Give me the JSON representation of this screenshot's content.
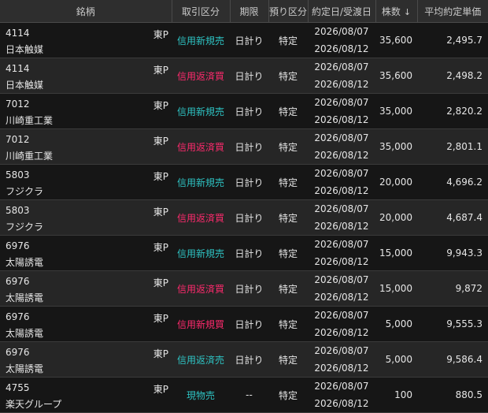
{
  "colors": {
    "buy": "#2ec4c4",
    "sell": "#ff2a6d",
    "text": "#e6e6e6",
    "header_bg": "#2e2e2e"
  },
  "headers": {
    "stock": "銘柄",
    "trade_type": "取引区分",
    "term": "期限",
    "custody": "預り区分",
    "dates": "約定日/受渡日",
    "qty": "株数",
    "sort_icon": "↓",
    "avg_price": "平均約定単価"
  },
  "rows": [
    {
      "code": "4114",
      "name": "日本触媒",
      "market": "東P",
      "trade_type": "信用新規売",
      "trade_kind": "buy",
      "term": "日計り",
      "custody": "特定",
      "trade_date": "2026/08/07",
      "settle_date": "2026/08/12",
      "qty": "35,600",
      "price": "2,495.7"
    },
    {
      "code": "4114",
      "name": "日本触媒",
      "market": "東P",
      "trade_type": "信用返済買",
      "trade_kind": "sell",
      "term": "日計り",
      "custody": "特定",
      "trade_date": "2026/08/07",
      "settle_date": "2026/08/12",
      "qty": "35,600",
      "price": "2,498.2"
    },
    {
      "code": "7012",
      "name": "川崎重工業",
      "market": "東P",
      "trade_type": "信用新規売",
      "trade_kind": "buy",
      "term": "日計り",
      "custody": "特定",
      "trade_date": "2026/08/07",
      "settle_date": "2026/08/12",
      "qty": "35,000",
      "price": "2,820.2"
    },
    {
      "code": "7012",
      "name": "川崎重工業",
      "market": "東P",
      "trade_type": "信用返済買",
      "trade_kind": "sell",
      "term": "日計り",
      "custody": "特定",
      "trade_date": "2026/08/07",
      "settle_date": "2026/08/12",
      "qty": "35,000",
      "price": "2,801.1"
    },
    {
      "code": "5803",
      "name": "フジクラ",
      "market": "東P",
      "trade_type": "信用新規売",
      "trade_kind": "buy",
      "term": "日計り",
      "custody": "特定",
      "trade_date": "2026/08/07",
      "settle_date": "2026/08/12",
      "qty": "20,000",
      "price": "4,696.2"
    },
    {
      "code": "5803",
      "name": "フジクラ",
      "market": "東P",
      "trade_type": "信用返済買",
      "trade_kind": "sell",
      "term": "日計り",
      "custody": "特定",
      "trade_date": "2026/08/07",
      "settle_date": "2026/08/12",
      "qty": "20,000",
      "price": "4,687.4"
    },
    {
      "code": "6976",
      "name": "太陽誘電",
      "market": "東P",
      "trade_type": "信用新規売",
      "trade_kind": "buy",
      "term": "日計り",
      "custody": "特定",
      "trade_date": "2026/08/07",
      "settle_date": "2026/08/12",
      "qty": "15,000",
      "price": "9,943.3"
    },
    {
      "code": "6976",
      "name": "太陽誘電",
      "market": "東P",
      "trade_type": "信用返済買",
      "trade_kind": "sell",
      "term": "日計り",
      "custody": "特定",
      "trade_date": "2026/08/07",
      "settle_date": "2026/08/12",
      "qty": "15,000",
      "price": "9,872"
    },
    {
      "code": "6976",
      "name": "太陽誘電",
      "market": "東P",
      "trade_type": "信用新規買",
      "trade_kind": "sell",
      "term": "日計り",
      "custody": "特定",
      "trade_date": "2026/08/07",
      "settle_date": "2026/08/12",
      "qty": "5,000",
      "price": "9,555.3"
    },
    {
      "code": "6976",
      "name": "太陽誘電",
      "market": "東P",
      "trade_type": "信用返済売",
      "trade_kind": "buy",
      "term": "日計り",
      "custody": "特定",
      "trade_date": "2026/08/07",
      "settle_date": "2026/08/12",
      "qty": "5,000",
      "price": "9,586.4"
    },
    {
      "code": "4755",
      "name": "楽天グループ",
      "market": "東P",
      "trade_type": "現物売",
      "trade_kind": "buy",
      "term": "--",
      "custody": "特定",
      "trade_date": "2026/08/07",
      "settle_date": "2026/08/12",
      "qty": "100",
      "price": "880.5"
    }
  ]
}
